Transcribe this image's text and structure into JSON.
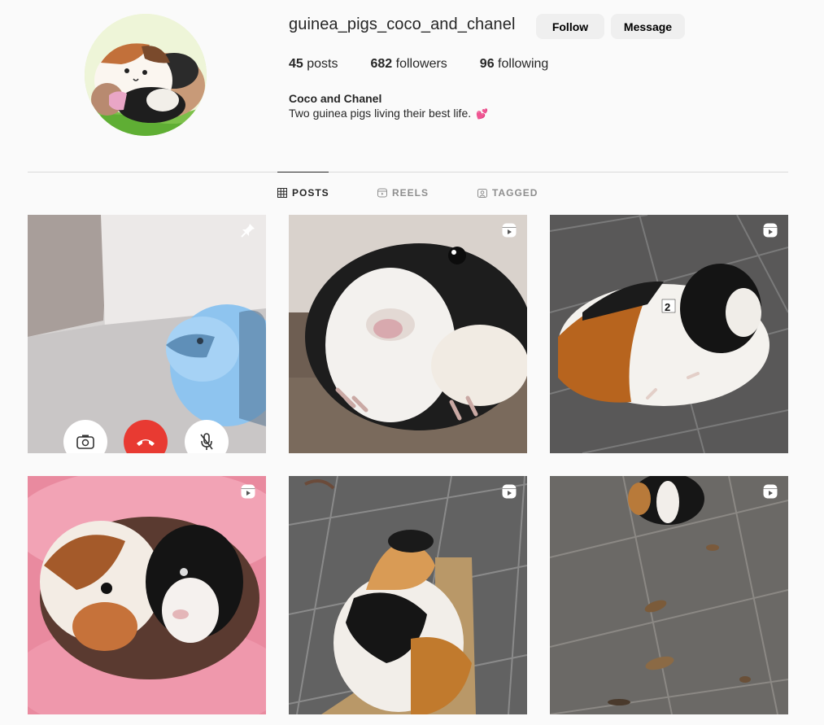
{
  "profile": {
    "username": "guinea_pigs_coco_and_chanel",
    "follow_label": "Follow",
    "message_label": "Message",
    "posts_count": "45",
    "posts_label": "posts",
    "followers_count": "682",
    "followers_label": "followers",
    "following_count": "96",
    "following_label": "following",
    "display_name": "Coco and Chanel",
    "bio": "Two guinea pigs living their best life.",
    "bio_emoji": "💕"
  },
  "tabs": [
    {
      "label": "POSTS",
      "icon": "grid-icon",
      "active": true
    },
    {
      "label": "REELS",
      "icon": "reels-icon",
      "active": false
    },
    {
      "label": "TAGGED",
      "icon": "tagged-icon",
      "active": false
    }
  ],
  "posts": [
    {
      "badge": "pin-icon",
      "subject": "video call screenshot of a guinea pig"
    },
    {
      "badge": "reel-icon",
      "subject": "close-up black and white guinea pig"
    },
    {
      "badge": "reel-icon",
      "subject": "tricolor guinea pig on tiled floor"
    },
    {
      "badge": "reel-icon",
      "subject": "two guinea pigs in pink fluffy bed"
    },
    {
      "badge": "reel-icon",
      "subject": "guinea pig from behind on tiles"
    },
    {
      "badge": "reel-icon",
      "subject": "guinea pig eating on tiled floor"
    }
  ],
  "colors": {
    "background": "#fafafa",
    "button_bg": "#efefef",
    "divider": "#dbdbdb",
    "muted_text": "#8e8e8e",
    "end_call_red": "#e83a32"
  }
}
